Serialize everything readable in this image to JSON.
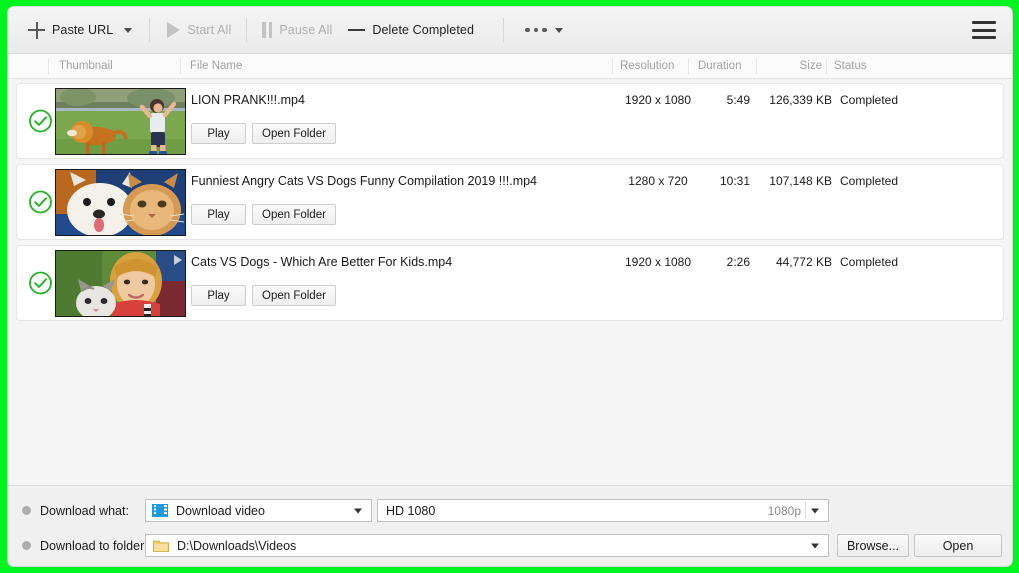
{
  "accent": {
    "highlight_green": "#00f520",
    "status_check_green": "#22b422",
    "video_icon_blue": "#1e9ae0",
    "folder_icon_yellow": "#f5cc52"
  },
  "toolbar": {
    "paste_url_label": "Paste URL",
    "paste_url_icon": "plus-icon",
    "paste_url_caret_icon": "chevron-down-icon",
    "start_all_label": "Start All",
    "start_all_icon": "play-icon",
    "start_all_enabled": false,
    "pause_all_label": "Pause All",
    "pause_all_icon": "pause-icon",
    "pause_all_enabled": false,
    "delete_completed_label": "Delete Completed",
    "delete_completed_icon": "minus-icon",
    "more_icon": "ellipsis-icon",
    "more_caret_icon": "chevron-down-icon",
    "menu_icon": "hamburger-menu-icon"
  },
  "columns": {
    "thumbnail": "Thumbnail",
    "file_name": "File Name",
    "resolution": "Resolution",
    "duration": "Duration",
    "size": "Size",
    "status": "Status"
  },
  "rows": [
    {
      "status_icon": "check-circle-icon",
      "file_name": "LION PRANK!!!.mp4",
      "resolution": "1920 x 1080",
      "duration": "5:49",
      "size": "126,339 KB",
      "status": "Completed",
      "play_label": "Play",
      "open_folder_label": "Open Folder"
    },
    {
      "status_icon": "check-circle-icon",
      "file_name": "Funniest Angry Cats VS Dogs Funny Compilation 2019 !!!.mp4",
      "resolution": "1280 x 720",
      "duration": "10:31",
      "size": "107,148 KB",
      "status": "Completed",
      "play_label": "Play",
      "open_folder_label": "Open Folder"
    },
    {
      "status_icon": "check-circle-icon",
      "file_name": "Cats VS Dogs - Which Are Better For Kids.mp4",
      "resolution": "1920 x 1080",
      "duration": "2:26",
      "size": "44,772 KB",
      "status": "Completed",
      "play_label": "Play",
      "open_folder_label": "Open Folder"
    }
  ],
  "bottom": {
    "download_what_label": "Download what:",
    "download_what_value": "Download video",
    "download_what_icon": "film-strip-icon",
    "quality_value": "HD 1080",
    "quality_right_value": "1080p",
    "download_to_folder_label": "Download to folder:",
    "folder_value": "D:\\Downloads\\Videos",
    "folder_icon": "folder-icon",
    "browse_label": "Browse...",
    "open_label": "Open"
  }
}
